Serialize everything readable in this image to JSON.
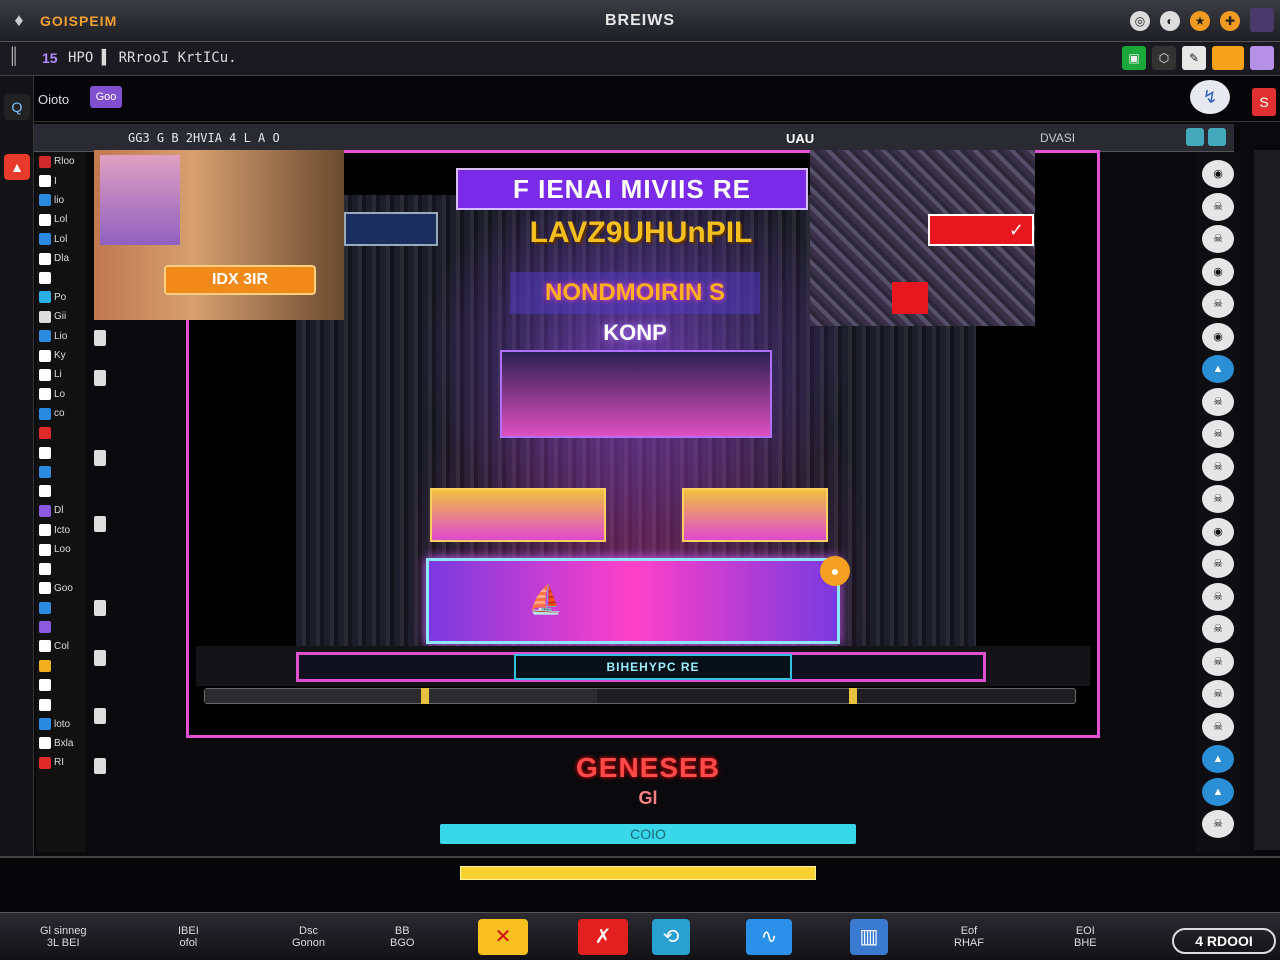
{
  "titlebar": {
    "app_name": "GOISPEIM",
    "window_title": "BREIWS",
    "icons": [
      "gamepad-icon",
      "headset-icon",
      "trophy-icon",
      "puzzle-icon"
    ]
  },
  "menubar": {
    "version": "15",
    "path": "HPO ▌ RRrooI KrtICu.",
    "right_icons": [
      "green-app-icon",
      "share-icon",
      "brush-icon",
      "orange-app-icon",
      "violet-app-icon"
    ]
  },
  "toolbar2": {
    "label": "Oioto",
    "tag": "Goo",
    "search_icon": "search-icon",
    "corner_label": "S"
  },
  "tabrow": {
    "left_label": "GG3  G B  2HVIA 4 L  A  O",
    "mid_label": "UAU",
    "right_label": "DVASI"
  },
  "side_list": [
    {
      "label": "Rloo",
      "color": "#d02a2a"
    },
    {
      "label": "I",
      "color": "#ffffff"
    },
    {
      "label": "lio",
      "color": "#2a8ae0"
    },
    {
      "label": "Lol",
      "color": "#ffffff"
    },
    {
      "label": "Lol",
      "color": "#2a8ae0"
    },
    {
      "label": "Dla",
      "color": "#ffffff"
    },
    {
      "label": "",
      "color": "#ffffff"
    },
    {
      "label": "Po",
      "color": "#2ab0e0"
    },
    {
      "label": "Gii",
      "color": "#dddddd"
    },
    {
      "label": "Lio",
      "color": "#2a8ae0"
    },
    {
      "label": "Ky",
      "color": "#ffffff"
    },
    {
      "label": "Li",
      "color": "#ffffff"
    },
    {
      "label": "Lo",
      "color": "#ffffff"
    },
    {
      "label": "co",
      "color": "#2a8ae0"
    },
    {
      "label": "",
      "color": "#e02a2a"
    },
    {
      "label": "",
      "color": "#ffffff"
    },
    {
      "label": "",
      "color": "#2a8ae0"
    },
    {
      "label": "",
      "color": "#ffffff"
    },
    {
      "label": "Dl",
      "color": "#8a5ae0"
    },
    {
      "label": "Icto",
      "color": "#ffffff"
    },
    {
      "label": "Loo",
      "color": "#ffffff"
    },
    {
      "label": "",
      "color": "#ffffff"
    },
    {
      "label": "Goo",
      "color": "#ffffff"
    },
    {
      "label": "",
      "color": "#2a8ae0"
    },
    {
      "label": "",
      "color": "#8a5ae0"
    },
    {
      "label": "Col",
      "color": "#ffffff"
    },
    {
      "label": "",
      "color": "#f2b020"
    },
    {
      "label": "",
      "color": "#ffffff"
    },
    {
      "label": "",
      "color": "#ffffff"
    },
    {
      "label": "loto",
      "color": "#2a8ae0"
    },
    {
      "label": "Bxla",
      "color": "#ffffff"
    },
    {
      "label": "RI",
      "color": "#e02a2a"
    }
  ],
  "game": {
    "banner": "F IENAI MIVIIS RE",
    "sub_banner": "LAVZ9UHUnPIL",
    "neon_sign": "NONDMOIRIN S",
    "neon_sub": "KONP",
    "left_button": "IDX 3IR",
    "red_badge": "✓",
    "hud_label": "BIHEHYPC RE",
    "progress": 0.45,
    "game_over": "GENESEB",
    "game_over_sub": "Gl",
    "cyan_button": "COIO",
    "pool_icon": "boat-icon",
    "ball_icon": "ball-icon"
  },
  "right_rail_icons": [
    "mask-icon",
    "skull-icon",
    "skull-icon",
    "mask-icon",
    "skull-icon",
    "mask-icon",
    "blue-app-icon",
    "skull-icon",
    "skull-icon",
    "skull-icon",
    "skull-icon",
    "mask-icon",
    "skull-icon",
    "skull-icon",
    "skull-icon",
    "skull-icon",
    "skull-icon",
    "skull-icon",
    "blue-app-icon",
    "blue-app-icon",
    "skull-icon"
  ],
  "taskbar": {
    "items": [
      {
        "label": "Gl sinneg",
        "sub": "3L  BEI"
      },
      {
        "label": "IBEI",
        "sub": "ofol"
      },
      {
        "label": "Dsc",
        "sub": "Gonon"
      },
      {
        "label": "BB",
        "sub": "BGO"
      },
      {
        "label": "Eof",
        "sub": "RHAF"
      },
      {
        "label": "EOI",
        "sub": "BHE"
      }
    ],
    "tiles": [
      "map-pin-icon",
      "close-icon",
      "refresh-icon",
      "wave-icon",
      "chart-icon"
    ],
    "right_box": "4 RDOOI"
  }
}
